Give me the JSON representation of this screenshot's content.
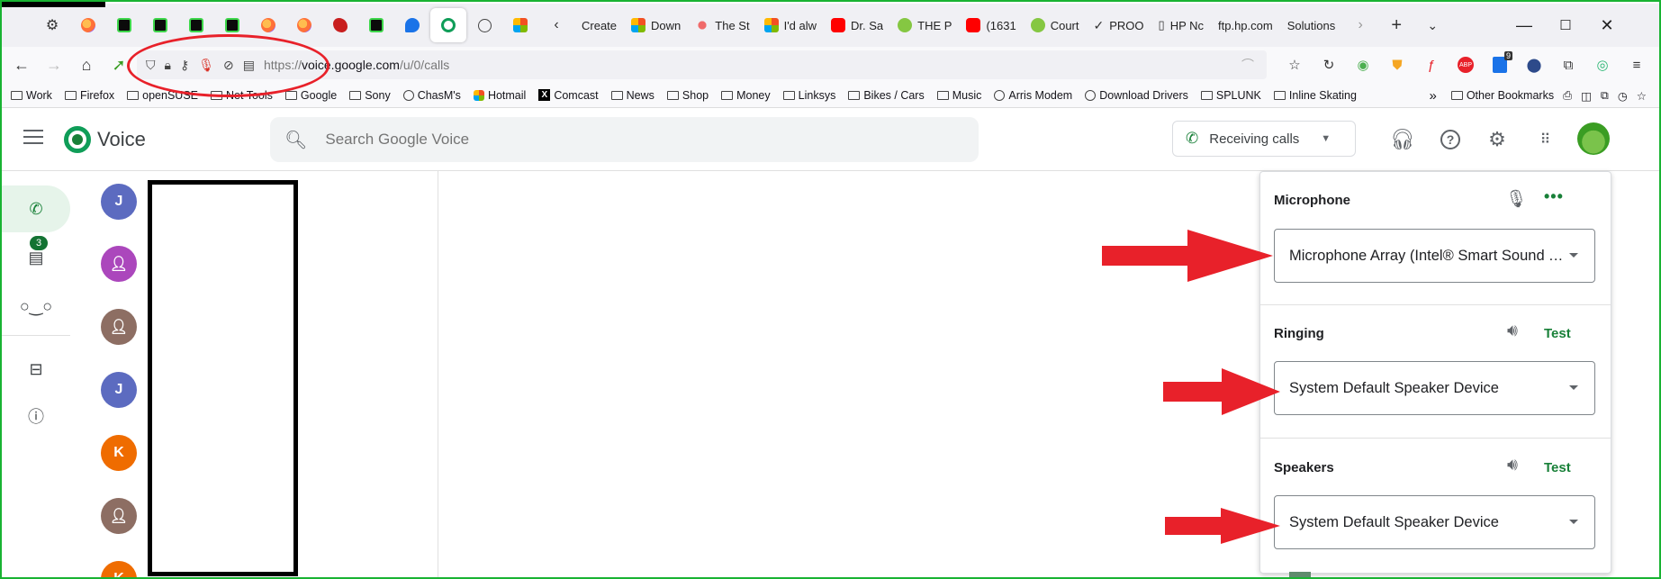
{
  "browser": {
    "tabs": [
      {
        "icon": "gear-icon",
        "label": ""
      },
      {
        "icon": "firefox-icon",
        "label": ""
      },
      {
        "icon": "terminal-icon",
        "label": ""
      },
      {
        "icon": "terminal-icon",
        "label": ""
      },
      {
        "icon": "terminal-icon",
        "label": ""
      },
      {
        "icon": "terminal-icon",
        "label": ""
      },
      {
        "icon": "firefox-icon",
        "label": ""
      },
      {
        "icon": "firefox-icon",
        "label": ""
      },
      {
        "icon": "red-bird-icon",
        "label": ""
      },
      {
        "icon": "terminal-icon",
        "label": ""
      },
      {
        "icon": "chat-bubble-icon",
        "label": ""
      },
      {
        "icon": "google-voice-icon",
        "label": ""
      },
      {
        "icon": "globe-icon",
        "label": ""
      },
      {
        "icon": "microsoft-icon",
        "label": ""
      },
      {
        "icon": "chevron-left-icon",
        "label": ""
      },
      {
        "icon": "",
        "label": "Create"
      },
      {
        "icon": "microsoft-icon",
        "label": "Down"
      },
      {
        "icon": "asana-icon",
        "label": "The St"
      },
      {
        "icon": "microsoft-icon",
        "label": "I'd alw"
      },
      {
        "icon": "youtube-icon",
        "label": "Dr. Sa"
      },
      {
        "icon": "rumble-icon",
        "label": "THE P"
      },
      {
        "icon": "youtube-icon",
        "label": "(1631"
      },
      {
        "icon": "rumble-icon",
        "label": "Court"
      },
      {
        "icon": "bird-icon",
        "label": "PROO"
      },
      {
        "icon": "page-icon",
        "label": "HP Nc"
      },
      {
        "icon": "",
        "label": "ftp.hp.com"
      },
      {
        "icon": "",
        "label": "Solutions"
      }
    ],
    "url_prefix": "https://",
    "url_domain": "voice.google.com",
    "url_path": "/u/0/calls",
    "bookmarks": [
      {
        "type": "folder",
        "label": "Work"
      },
      {
        "type": "folder",
        "label": "Firefox"
      },
      {
        "type": "folder",
        "label": "openSUSE"
      },
      {
        "type": "folder",
        "label": "Net Tools"
      },
      {
        "type": "folder",
        "label": "Google"
      },
      {
        "type": "folder",
        "label": "Sony"
      },
      {
        "type": "globe",
        "label": "ChasM's"
      },
      {
        "type": "page",
        "label": "Hotmail"
      },
      {
        "type": "x",
        "label": "Comcast"
      },
      {
        "type": "folder",
        "label": "News"
      },
      {
        "type": "folder",
        "label": "Shop"
      },
      {
        "type": "folder",
        "label": "Money"
      },
      {
        "type": "folder",
        "label": "Linksys"
      },
      {
        "type": "folder",
        "label": "Bikes / Cars"
      },
      {
        "type": "folder",
        "label": "Music"
      },
      {
        "type": "globe",
        "label": "Arris Modem"
      },
      {
        "type": "globe",
        "label": "Download Drivers"
      },
      {
        "type": "folder",
        "label": "SPLUNK"
      },
      {
        "type": "folder",
        "label": "Inline Skating"
      }
    ],
    "overflow_chevron": "»",
    "other_bookmarks": "Other Bookmarks",
    "extension_badge": "9"
  },
  "app": {
    "title": "Voice",
    "search_placeholder": "Search Google Voice",
    "receiving_label": "Receiving calls",
    "messages_badge": "3",
    "contacts": [
      {
        "initial": "J",
        "color": "#5c6bc0"
      },
      {
        "initial": "",
        "color": "#ab47bc"
      },
      {
        "initial": "",
        "color": "#8d6e63"
      },
      {
        "initial": "J",
        "color": "#5c6bc0"
      },
      {
        "initial": "K",
        "color": "#ef6c00"
      },
      {
        "initial": "",
        "color": "#8d6e63"
      },
      {
        "initial": "K",
        "color": "#ef6c00"
      }
    ]
  },
  "audio_panel": {
    "microphone": {
      "title": "Microphone",
      "device": "Microphone Array (Intel® Smart Sound Technology for Digital Microphones)"
    },
    "ringing": {
      "title": "Ringing",
      "test": "Test",
      "device": "System Default Speaker Device"
    },
    "speakers": {
      "title": "Speakers",
      "test": "Test",
      "device": "System Default Speaker Device"
    }
  },
  "colors": {
    "accent_green": "#188038",
    "window_border": "#19b332",
    "annotation_red": "#e8212a"
  }
}
